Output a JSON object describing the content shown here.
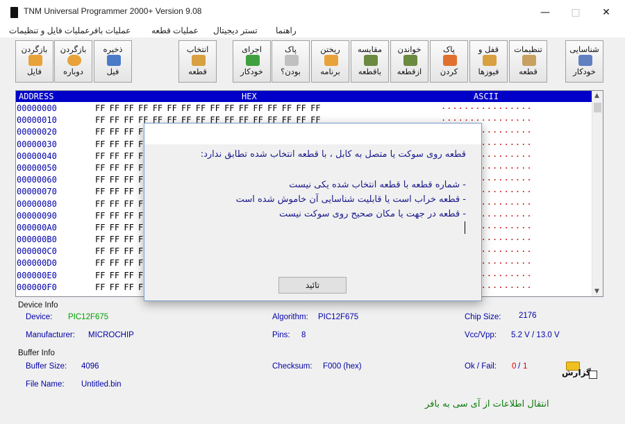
{
  "window": {
    "title": "TNM  Universal Programmer 2000+    Version 9.08",
    "minimize": "—",
    "maximize": "□",
    "close": "✕"
  },
  "menu": [
    {
      "label": "عملیات فایل و تنظیمات"
    },
    {
      "label": "عملیات بافر"
    },
    {
      "label": "عملیات قطعه"
    },
    {
      "label": "تستر دیجیتال"
    },
    {
      "label": "راهنما"
    }
  ],
  "toolbar": [
    {
      "line1": "بازگردن",
      "line2": "فایل",
      "color": "#e8a23a"
    },
    {
      "line1": "بازگردن",
      "line2": "دوباره",
      "color": "#e8a23a"
    },
    {
      "line1": "ذخیره",
      "line2": "فیل",
      "color": "#4a7bc8"
    },
    {
      "line1": "انتخاب",
      "line2": "قطعه",
      "color": "#d8a040"
    },
    {
      "line1": "اجرای",
      "line2": "خودکار",
      "color": "#40a040"
    },
    {
      "line1": "پاک",
      "line2": "بودن؟",
      "color": "#c0c0c0"
    },
    {
      "line1": "ریختن",
      "line2": "برنامه",
      "color": "#e8a23a"
    },
    {
      "line1": "مقایسه",
      "line2": "باقطعه",
      "color": "#6a8a40"
    },
    {
      "line1": "خواندن",
      "line2": "ازقطعه",
      "color": "#6a8a40"
    },
    {
      "line1": "پاک",
      "line2": "کردن",
      "color": "#e07030"
    },
    {
      "line1": "قفل و",
      "line2": "فیوزها",
      "color": "#d8a040"
    },
    {
      "line1": "تنظیمات",
      "line2": "قطعه",
      "color": "#c8a060"
    },
    {
      "line1": "شناسایی",
      "line2": "خودکار",
      "color": "#6080c0"
    }
  ],
  "hex": {
    "headers": {
      "address": "ADDRESS",
      "hex": "HEX",
      "ascii": "ASCII"
    },
    "rows": [
      {
        "address": "00000000",
        "bytes": "FF FF FF FF FF FF FF FF FF FF FF FF FF FF FF FF",
        "ascii": "................"
      },
      {
        "address": "00000010",
        "bytes": "FF FF FF FF FF FF FF FF FF FF FF FF FF FF FF FF",
        "ascii": "................"
      },
      {
        "address": "00000020",
        "bytes": "FF FF FF FF FF FF FF FF FF FF FF FF FF FF FF FF",
        "ascii": "................"
      },
      {
        "address": "00000030",
        "bytes": "FF FF FF FF FF FF FF FF FF FF FF FF FF FF FF FF",
        "ascii": "................"
      },
      {
        "address": "00000040",
        "bytes": "FF FF FF FF FF FF FF FF FF FF FF FF FF FF FF FF",
        "ascii": "................"
      },
      {
        "address": "00000050",
        "bytes": "FF FF FF FF FF FF FF FF FF FF FF FF FF FF FF FF",
        "ascii": "................"
      },
      {
        "address": "00000060",
        "bytes": "FF FF FF FF FF FF FF FF FF FF FF FF FF FF FF FF",
        "ascii": "................"
      },
      {
        "address": "00000070",
        "bytes": "FF FF FF FF FF FF FF FF FF FF FF FF FF FF FF FF",
        "ascii": "................"
      },
      {
        "address": "00000080",
        "bytes": "FF FF FF FF FF FF FF FF FF FF FF FF FF FF FF FF",
        "ascii": "................"
      },
      {
        "address": "00000090",
        "bytes": "FF FF FF FF FF FF FF FF FF FF FF FF FF FF FF FF",
        "ascii": "................"
      },
      {
        "address": "000000A0",
        "bytes": "FF FF FF FF FF FF FF FF FF FF FF FF FF FF FF FF",
        "ascii": "................"
      },
      {
        "address": "000000B0",
        "bytes": "FF FF FF FF FF FF FF FF FF FF FF FF FF FF FF FF",
        "ascii": "................"
      },
      {
        "address": "000000C0",
        "bytes": "FF FF FF FF FF FF FF FF FF FF FF FF FF FF FF FF",
        "ascii": "................"
      },
      {
        "address": "000000D0",
        "bytes": "FF FF FF FF FF FF FF FF FF FF FF FF FF FF FF FF",
        "ascii": "................"
      },
      {
        "address": "000000E0",
        "bytes": "FF FF FF FF FF FF FF FF FF FF FF FF FF FF FF FF",
        "ascii": "................"
      },
      {
        "address": "000000F0",
        "bytes": "FF FF FF FF FF FF FF FF FF FF FF FF FF FF FF FF",
        "ascii": "................"
      }
    ]
  },
  "device_info": {
    "section": "Device Info",
    "device_label": "Device:",
    "device": "PIC12F675",
    "manufacturer_label": "Manufacturer:",
    "manufacturer": "MICROCHIP",
    "algorithm_label": "Algorithm:",
    "algorithm": "PIC12F675",
    "pins_label": "Pins:",
    "pins": "8",
    "chip_size_label": "Chip Size:",
    "chip_size": "2176",
    "vcc_label": "Vcc/Vpp:",
    "vcc": "5.2 V / 13.0 V"
  },
  "buffer_info": {
    "section": "Buffer Info",
    "buffer_size_label": "Buffer Size:",
    "buffer_size": "4096",
    "file_name_label": "File Name:",
    "file_name": "Untitled.bin",
    "checksum_label": "Checksum:",
    "checksum": "F000 (hex)",
    "okfail_label": "Ok / Fail:",
    "ok": "0",
    "sep": "/",
    "fail": "1"
  },
  "report_label": "گزارش",
  "status_text": "انتقال اطلاعات از آی سی به بافر",
  "dialog": {
    "line1": "قطعه روی سوکت یا متصل به کابل ، با قطعه انتخاب شده تطابق ندارد:",
    "line2": "- شماره قطعه با قطعه انتخاب شده یکی نیست",
    "line3": "- قطعه خراب است یا قابلیت شناسایی آن خاموش شده است",
    "line4": "- قطعه در جهت یا مکان صحیح روی سوکت نیست",
    "ok_button": "تائید"
  }
}
